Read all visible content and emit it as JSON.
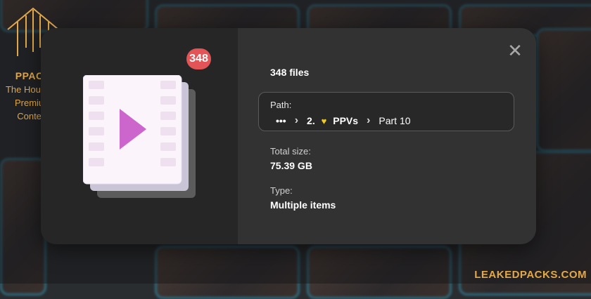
{
  "logo": {
    "name": "PPACK",
    "tagline_lines": [
      "The House of",
      "Premium",
      "Content"
    ]
  },
  "modal": {
    "badge_count": "348",
    "files_count": "348 files",
    "path": {
      "label": "Path:",
      "ellipsis": "•••",
      "crumbs": [
        "2.",
        "PPVs",
        "Part 10"
      ]
    },
    "total_size": {
      "label": "Total size:",
      "value": "75.39 GB"
    },
    "type": {
      "label": "Type:",
      "value": "Multiple items"
    },
    "close_symbol": "✕"
  },
  "watermark": "LEAKEDPACKS.COM",
  "colors": {
    "badge": "#e35456",
    "accent_gold": "#e2a84a",
    "play": "#cc66cc",
    "heart": "#f2cc1c"
  }
}
